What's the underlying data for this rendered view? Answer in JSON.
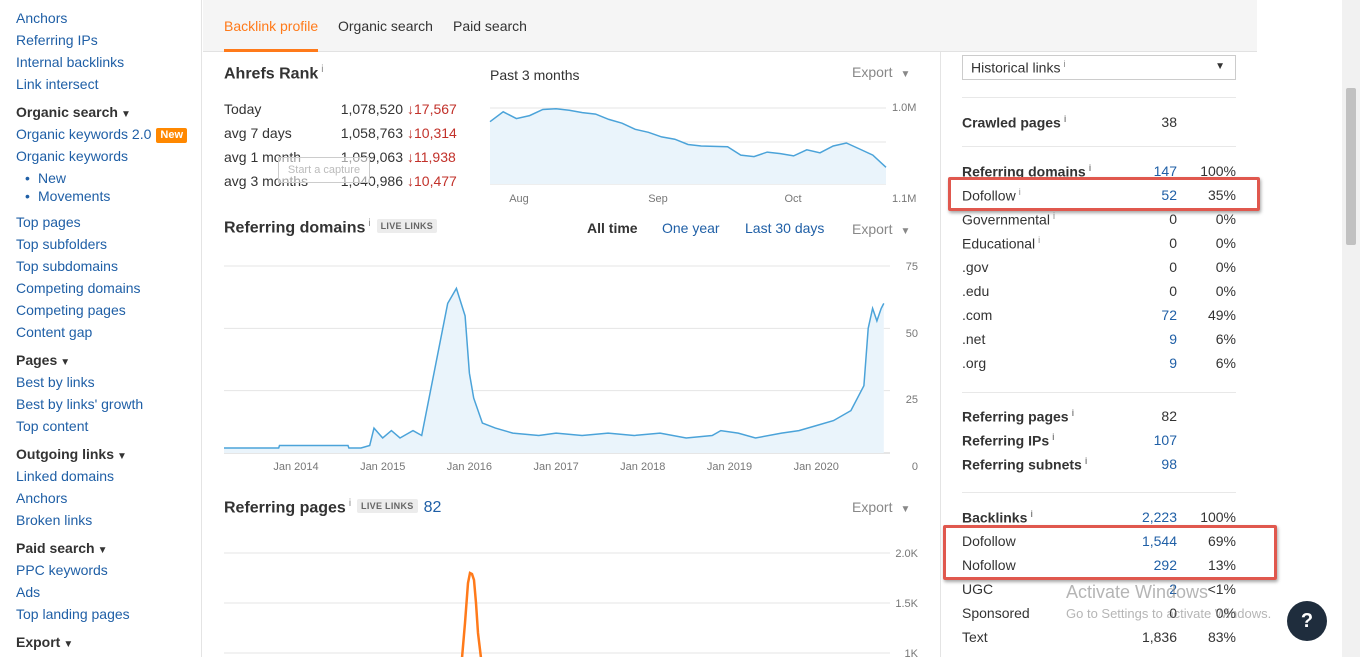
{
  "sidebar": {
    "items_top": [
      "Anchors",
      "Referring IPs",
      "Internal backlinks",
      "Link intersect"
    ],
    "organic_head": "Organic search",
    "organic_kw2": "Organic keywords 2.0",
    "new_badge": "New",
    "organic_items": [
      "Organic keywords"
    ],
    "organic_sub": [
      "New",
      "Movements"
    ],
    "organic_items2": [
      "Top pages",
      "Top subfolders",
      "Top subdomains",
      "Competing domains",
      "Competing pages",
      "Content gap"
    ],
    "pages_head": "Pages",
    "pages_items": [
      "Best by links",
      "Best by links' growth",
      "Top content"
    ],
    "outgoing_head": "Outgoing links",
    "outgoing_items": [
      "Linked domains",
      "Anchors",
      "Broken links"
    ],
    "paid_head": "Paid search",
    "paid_items": [
      "PPC keywords",
      "Ads",
      "Top landing pages"
    ],
    "export_head": "Export"
  },
  "tabs": [
    "Backlink profile",
    "Organic search",
    "Paid search"
  ],
  "rank": {
    "title": "Ahrefs Rank",
    "info": "i",
    "period": "Past 3 months",
    "export": "Export",
    "rows": [
      {
        "label": "Today",
        "value": "1,078,520",
        "change": "↓17,567"
      },
      {
        "label": "avg 7 days",
        "value": "1,058,763",
        "change": "↓10,314"
      },
      {
        "label": "avg 1 month",
        "value": "1,059,063",
        "change": "↓11,938"
      },
      {
        "label": "avg 3 months",
        "value": "1,040,986",
        "change": "↓10,477"
      }
    ],
    "capture_text": "Start a capture"
  },
  "rank_chart": {
    "type": "line",
    "x_labels": [
      "Aug",
      "Sep",
      "Oct"
    ],
    "y_labels": [
      "1.0M",
      "1.1M"
    ],
    "y": [
      1018000,
      1005000,
      1014000,
      1010000,
      1002000,
      1001000,
      1003000,
      1006000,
      1008000,
      1015000,
      1020000,
      1028000,
      1032000,
      1038000,
      1041000,
      1048000,
      1050000,
      1050500,
      1051000,
      1062000,
      1064000,
      1058000,
      1060000,
      1063000,
      1055000,
      1059000,
      1050000,
      1046000,
      1054000,
      1062000,
      1078000
    ],
    "color": "#4ba3d9"
  },
  "ref_domains": {
    "title": "Referring domains",
    "info": "i",
    "live": "LIVE LINKS",
    "ranges": [
      "All time",
      "One year",
      "Last 30 days"
    ],
    "export": "Export"
  },
  "ref_domains_chart": {
    "type": "area",
    "x_labels": [
      "Jan 2014",
      "Jan 2015",
      "Jan 2016",
      "Jan 2017",
      "Jan 2018",
      "Jan 2019",
      "Jan 2020"
    ],
    "y_labels": [
      "75",
      "50",
      "25",
      "0"
    ],
    "ylim": [
      0,
      75
    ],
    "x": [
      2013.0,
      2013.8,
      2013.81,
      2014.6,
      2014.61,
      2014.75,
      2014.85,
      2014.9,
      2015.0,
      2015.1,
      2015.2,
      2015.35,
      2015.45,
      2015.75,
      2015.85,
      2015.95,
      2016.0,
      2016.05,
      2016.15,
      2016.3,
      2016.5,
      2016.8,
      2017.0,
      2017.3,
      2017.6,
      2017.9,
      2018.2,
      2018.5,
      2018.8,
      2018.9,
      2019.1,
      2019.3,
      2019.6,
      2019.8,
      2020.0,
      2020.2,
      2020.4,
      2020.55,
      2020.6,
      2020.65,
      2020.7,
      2020.75,
      2020.78
    ],
    "y": [
      2,
      2,
      3,
      3,
      2,
      2,
      3,
      10,
      6,
      9,
      6,
      9,
      7,
      60,
      66,
      55,
      32,
      22,
      12,
      10,
      8,
      7,
      8,
      7,
      8,
      7,
      8,
      6,
      7,
      9,
      8,
      6,
      8,
      9,
      11,
      13,
      17,
      27,
      50,
      58,
      53,
      58,
      60
    ],
    "color": "#4ba3d9"
  },
  "ref_pages": {
    "title": "Referring pages",
    "info": "i",
    "live": "LIVE LINKS",
    "count": "82",
    "export": "Export"
  },
  "ref_pages_chart": {
    "type": "line",
    "y_labels": [
      "2.0K",
      "1.5K",
      "1K"
    ],
    "ylim": [
      1000,
      2000
    ],
    "x": [
      0,
      3,
      6,
      8,
      10,
      12,
      14,
      16,
      19,
      22
    ],
    "y": [
      950,
      1300,
      1700,
      1800,
      1790,
      1730,
      1500,
      1200,
      950,
      850
    ],
    "color": "#ff7a1a"
  },
  "right": {
    "select": "Historical links",
    "select_info": "i",
    "crawled": {
      "label": "Crawled pages",
      "value": "38"
    },
    "domains_rows": [
      {
        "label": "Referring domains",
        "num": "147",
        "pct": "100%",
        "bold": true,
        "blue": true
      },
      {
        "label": "Dofollow",
        "num": "52",
        "pct": "35%",
        "blue": true,
        "info": true
      },
      {
        "label": "Governmental",
        "num": "0",
        "pct": "0%",
        "info": true
      },
      {
        "label": "Educational",
        "num": "0",
        "pct": "0%",
        "info": true
      },
      {
        "label": ".gov",
        "num": "0",
        "pct": "0%"
      },
      {
        "label": ".edu",
        "num": "0",
        "pct": "0%"
      },
      {
        "label": ".com",
        "num": "72",
        "pct": "49%",
        "blue": true
      },
      {
        "label": ".net",
        "num": "9",
        "pct": "6%",
        "blue": true
      },
      {
        "label": ".org",
        "num": "9",
        "pct": "6%",
        "blue": true
      }
    ],
    "pages_rows": [
      {
        "label": "Referring pages",
        "num": "82",
        "bold": true
      },
      {
        "label": "Referring IPs",
        "num": "107",
        "bold": true,
        "blue": true
      },
      {
        "label": "Referring subnets",
        "num": "98",
        "bold": true,
        "blue": true
      }
    ],
    "backlinks_rows": [
      {
        "label": "Backlinks",
        "num": "2,223",
        "pct": "100%",
        "bold": true,
        "blue": true
      },
      {
        "label": "Dofollow",
        "num": "1,544",
        "pct": "69%",
        "blue": true
      },
      {
        "label": "Nofollow",
        "num": "292",
        "pct": "13%",
        "blue": true
      },
      {
        "label": "UGC",
        "num": "2",
        "pct": "<1%",
        "blue": true
      },
      {
        "label": "Sponsored",
        "num": "0",
        "pct": "0%"
      },
      {
        "label": "Text",
        "num": "1,836",
        "pct": "83%"
      }
    ]
  },
  "watermark": {
    "line1": "Activate Windows",
    "line2": "Go to Settings to activate Windows."
  },
  "help": "?"
}
